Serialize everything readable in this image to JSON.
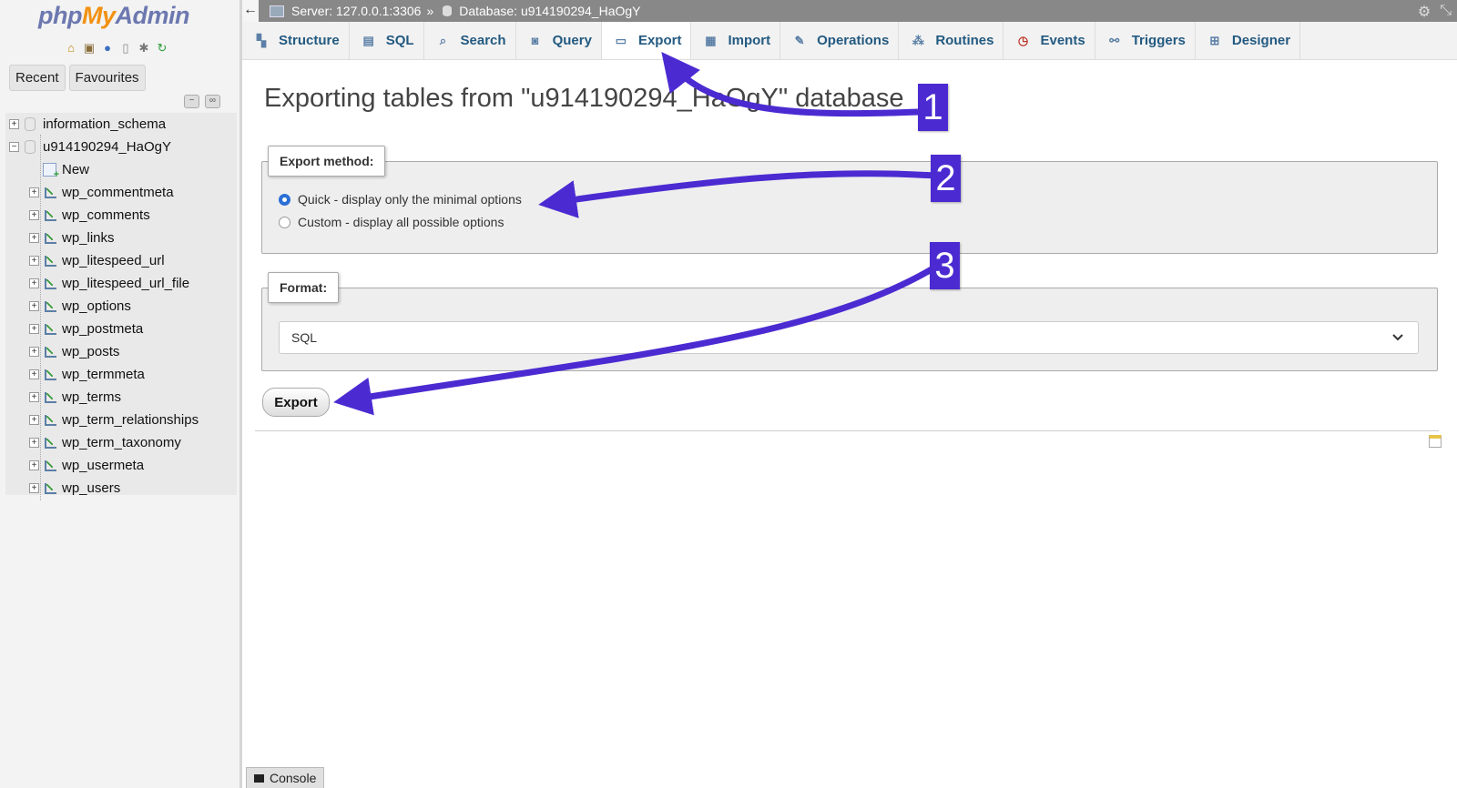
{
  "sidebar": {
    "logo": {
      "php": "php",
      "my": "My",
      "admin": "Admin"
    },
    "tabs": [
      "Recent",
      "Favourites"
    ],
    "databases": [
      {
        "name": "information_schema",
        "expanded": false
      },
      {
        "name": "u914190294_HaOgY",
        "expanded": true
      }
    ],
    "new_label": "New",
    "tables": [
      "wp_commentmeta",
      "wp_comments",
      "wp_links",
      "wp_litespeed_url",
      "wp_litespeed_url_file",
      "wp_options",
      "wp_postmeta",
      "wp_posts",
      "wp_termmeta",
      "wp_terms",
      "wp_term_relationships",
      "wp_term_taxonomy",
      "wp_usermeta",
      "wp_users"
    ]
  },
  "topbar": {
    "server": "Server: 127.0.0.1:3306",
    "separator": "»",
    "database": "Database: u914190294_HaOgY"
  },
  "tabs": [
    {
      "label": "Structure",
      "icon": "structure-icon",
      "active": false
    },
    {
      "label": "SQL",
      "icon": "sql-icon",
      "active": false
    },
    {
      "label": "Search",
      "icon": "search-icon",
      "active": false
    },
    {
      "label": "Query",
      "icon": "query-icon",
      "active": false
    },
    {
      "label": "Export",
      "icon": "export-icon",
      "active": true
    },
    {
      "label": "Import",
      "icon": "import-icon",
      "active": false
    },
    {
      "label": "Operations",
      "icon": "wrench-icon",
      "active": false
    },
    {
      "label": "Routines",
      "icon": "routines-icon",
      "active": false
    },
    {
      "label": "Events",
      "icon": "clock-icon",
      "active": false
    },
    {
      "label": "Triggers",
      "icon": "triggers-icon",
      "active": false
    },
    {
      "label": "Designer",
      "icon": "designer-icon",
      "active": false
    }
  ],
  "main": {
    "title": "Exporting tables from \"u914190294_HaOgY\" database",
    "export_method": {
      "legend": "Export method:",
      "options": [
        {
          "label": "Quick - display only the minimal options",
          "selected": true
        },
        {
          "label": "Custom - display all possible options",
          "selected": false
        }
      ]
    },
    "format": {
      "legend": "Format:",
      "selected": "SQL"
    },
    "export_button": "Export"
  },
  "console_label": "Console",
  "annotations": {
    "color": "#4b2bd1",
    "steps": [
      "1",
      "2",
      "3"
    ]
  }
}
